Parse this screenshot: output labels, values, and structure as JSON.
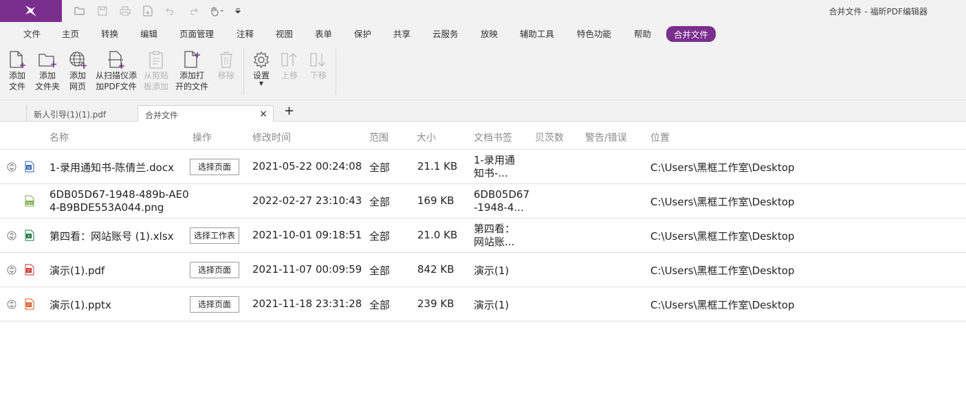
{
  "window": {
    "title": "合并文件 - 福昕PDF编辑器"
  },
  "quick_access": [
    "open-icon",
    "save-icon",
    "print-icon",
    "new-icon",
    "undo-icon",
    "redo-icon",
    "hand-tool-icon",
    "customize-icon"
  ],
  "menu": {
    "items": [
      "文件",
      "主页",
      "转换",
      "编辑",
      "页面管理",
      "注释",
      "视图",
      "表单",
      "保护",
      "共享",
      "云服务",
      "放映",
      "辅助工具",
      "特色功能",
      "帮助",
      "合并文件"
    ],
    "active_index": 15
  },
  "ribbon": {
    "add_file": [
      "添加",
      "文件"
    ],
    "add_folder": [
      "添加",
      "文件夹"
    ],
    "add_webpage": [
      "添加",
      "网页"
    ],
    "add_scanner": [
      "从扫描仪添",
      "加PDF文件"
    ],
    "add_clipboard": [
      "从剪贴",
      "板添加"
    ],
    "add_open": [
      "添加打",
      "开的文件"
    ],
    "remove": "移除",
    "settings": "设置",
    "move_up": "上移",
    "move_down": "下移"
  },
  "tabs": {
    "inactive": "新人引导(1)(1).pdf",
    "active": "合并文件",
    "close": "×",
    "add": "+"
  },
  "table": {
    "headers": [
      "名称",
      "操作",
      "修改时间",
      "范围",
      "大小",
      "文档书签",
      "贝茨数",
      "警告/错误",
      "位置"
    ],
    "rows": [
      {
        "icon": "word-file-icon",
        "expand": true,
        "name": [
          "1-录用通知书-陈倩兰.docx"
        ],
        "action": "选择页面",
        "modified": "2021-05-22 00:24:08",
        "range": "全部",
        "size": "21.1 KB",
        "bookmark": [
          "1-录用通",
          "知书-..."
        ],
        "location": "C:\\Users\\黑框工作室\\Desktop"
      },
      {
        "icon": "image-file-icon",
        "expand": false,
        "name": [
          "6DB05D67-1948-489b-AE0",
          "4-B9BDE553A044.png"
        ],
        "action": "",
        "modified": "2022-02-27 23:10:43",
        "range": "全部",
        "size": "169 KB",
        "bookmark": [
          "6DB05D67",
          "-1948-4..."
        ],
        "location": "C:\\Users\\黑框工作室\\Desktop"
      },
      {
        "icon": "excel-file-icon",
        "expand": true,
        "name": [
          "第四看：网站账号 (1).xlsx"
        ],
        "action": "选择工作表",
        "modified": "2021-10-01 09:18:51",
        "range": "全部",
        "size": "21.0 KB",
        "bookmark": [
          "第四看：",
          "网站账..."
        ],
        "location": "C:\\Users\\黑框工作室\\Desktop"
      },
      {
        "icon": "pdf-file-icon",
        "expand": true,
        "name": [
          "演示(1).pdf"
        ],
        "action": "选择页面",
        "modified": "2021-11-07 00:09:59",
        "range": "全部",
        "size": "842 KB",
        "bookmark": [
          "演示(1)"
        ],
        "location": "C:\\Users\\黑框工作室\\Desktop"
      },
      {
        "icon": "ppt-file-icon",
        "expand": true,
        "name": [
          "演示(1).pptx"
        ],
        "action": "选择页面",
        "modified": "2021-11-18 23:31:28",
        "range": "全部",
        "size": "239 KB",
        "bookmark": [
          "演示(1)"
        ],
        "location": "C:\\Users\\黑框工作室\\Desktop"
      }
    ]
  },
  "colors": {
    "accent": "#7a2e8e",
    "word": "#2b5fb4",
    "excel": "#1f7a3f",
    "pdf": "#c8322f",
    "ppt": "#d35b25",
    "image": "#7caa4a"
  }
}
